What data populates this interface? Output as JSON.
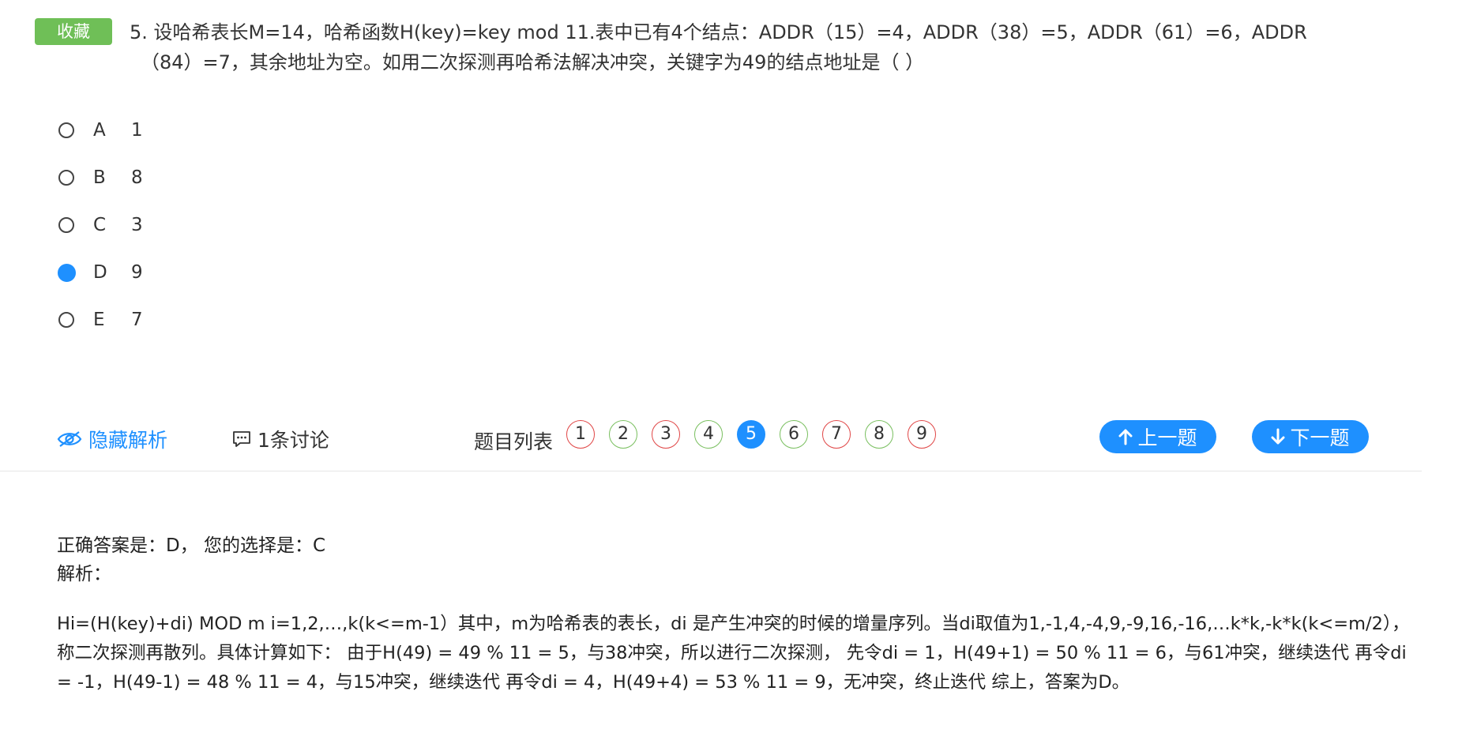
{
  "favorite_label": "收藏",
  "question": {
    "line1": "5. 设哈希表长M=14，哈希函数H(key)=key mod 11.表中已有4个结点：ADDR（15）=4，ADDR（38）=5，ADDR（61）=6，ADDR",
    "line2": "（84）=7，其余地址为空。如用二次探测再哈希法解决冲突，关键字为49的结点地址是（ ）"
  },
  "options": [
    {
      "letter": "A",
      "value": "1",
      "checked": false
    },
    {
      "letter": "B",
      "value": "8",
      "checked": false
    },
    {
      "letter": "C",
      "value": "3",
      "checked": false
    },
    {
      "letter": "D",
      "value": "9",
      "checked": true
    },
    {
      "letter": "E",
      "value": "7",
      "checked": false
    }
  ],
  "toolbar": {
    "hide_analysis": "隐藏解析",
    "discussion": "1条讨论",
    "question_list": "题目列表",
    "numbers": [
      "1",
      "2",
      "3",
      "4",
      "5",
      "6",
      "7",
      "8",
      "9"
    ],
    "number_states": [
      "red",
      "green",
      "red",
      "green",
      "current",
      "green",
      "red",
      "green",
      "red"
    ],
    "prev": "上一题",
    "next": "下一题"
  },
  "result": {
    "answer_line": "正确答案是：D，  您的选择是：C",
    "analysis_label": "解析："
  },
  "explanation": "Hi=(H(key)+di) MOD m i=1,2,…,k(k<=m-1）其中，m为哈希表的表长，di 是产生冲突的时候的增量序列。当di取值为1,-1,4,-4,9,-9,16,-16,…k*k,-k*k(k<=m/2），称二次探测再散列。具体计算如下： 由于H(49) = 49 % 11 = 5，与38冲突，所以进行二次探测， 先令di = 1，H(49+1) = 50 % 11 = 6，与61冲突，继续迭代 再令di = -1，H(49-1) = 48 % 11 = 4，与15冲突，继续迭代 再令di = 4，H(49+4) = 53 % 11 = 9，无冲突，终止迭代 综上，答案为D。",
  "colors": {
    "accent": "#1e90ff",
    "badge_green": "#6fbf57",
    "circle_red": "#e04646",
    "circle_green": "#79bf5f"
  }
}
